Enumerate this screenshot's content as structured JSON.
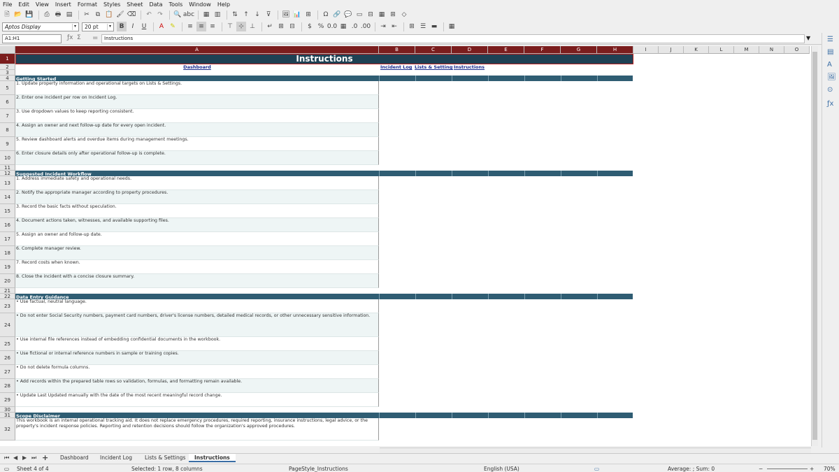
{
  "menu": [
    "File",
    "Edit",
    "View",
    "Insert",
    "Format",
    "Styles",
    "Sheet",
    "Data",
    "Tools",
    "Window",
    "Help"
  ],
  "toolbar": {
    "font_name": "Aptos Display",
    "font_size": "20 pt"
  },
  "formula_bar": {
    "cell_ref": "A1:H1",
    "content": "Instructions"
  },
  "columns": [
    "A",
    "B",
    "C",
    "D",
    "E",
    "F",
    "G",
    "H",
    "I",
    "J",
    "K",
    "L",
    "M",
    "N",
    "O"
  ],
  "sheet": {
    "title": "Instructions",
    "links": [
      "Dashboard",
      "Incident Log",
      "Lists & Settings",
      "Instructions"
    ],
    "sections": [
      {
        "header": "Getting Started",
        "items": [
          "1. Update property information and operational targets on Lists & Settings.",
          "2. Enter one incident per row on Incident Log.",
          "3. Use dropdown values to keep reporting consistent.",
          "4. Assign an owner and next follow-up date for every open incident.",
          "5. Review dashboard alerts and overdue items during management meetings.",
          "6. Enter closure details only after operational follow-up is complete."
        ]
      },
      {
        "header": "Suggested Incident Workflow",
        "items": [
          "1. Address immediate safety and operational needs.",
          "2. Notify the appropriate manager according to property procedures.",
          "3. Record the basic facts without speculation.",
          "4. Document actions taken, witnesses, and available supporting files.",
          "5. Assign an owner and follow-up date.",
          "6. Complete manager review.",
          "7. Record costs when known.",
          "8. Close the incident with a concise closure summary."
        ]
      },
      {
        "header": "Data Entry Guidance",
        "items": [
          "• Use factual, neutral language.",
          "• Do not enter Social Security numbers, payment card numbers, driver's license numbers, detailed medical records, or other unnecessary sensitive information.",
          "• Use internal file references instead of embedding confidential documents in the workbook.",
          "• Use fictional or internal reference numbers in sample or training copies.",
          "• Do not delete formula columns.",
          "• Add records within the prepared table rows so validation, formulas, and formatting remain available.",
          "• Update Last Updated manually with the date of the most recent meaningful record change."
        ]
      },
      {
        "header": "Scope Disclaimer",
        "items": [
          "This workbook is an internal operational tracking aid. It does not replace emergency procedures, required reporting, insurance instructions, legal advice, or the property's incident response policies. Reporting and retention decisions should follow the organization's approved procedures."
        ]
      }
    ]
  },
  "tabs": [
    "Dashboard",
    "Incident Log",
    "Lists & Settings",
    "Instructions"
  ],
  "active_tab": "Instructions",
  "status": {
    "sheet": "Sheet 4 of 4",
    "selection": "Selected: 1 row, 8 columns",
    "page_style": "PageStyle_Instructions",
    "language": "English (USA)",
    "stats": "Average: ; Sum: 0",
    "zoom": "70%"
  },
  "colors": {
    "section_band": "#2f5d73",
    "title_bg": "#1e4154",
    "selection": "#7b1d1d"
  }
}
